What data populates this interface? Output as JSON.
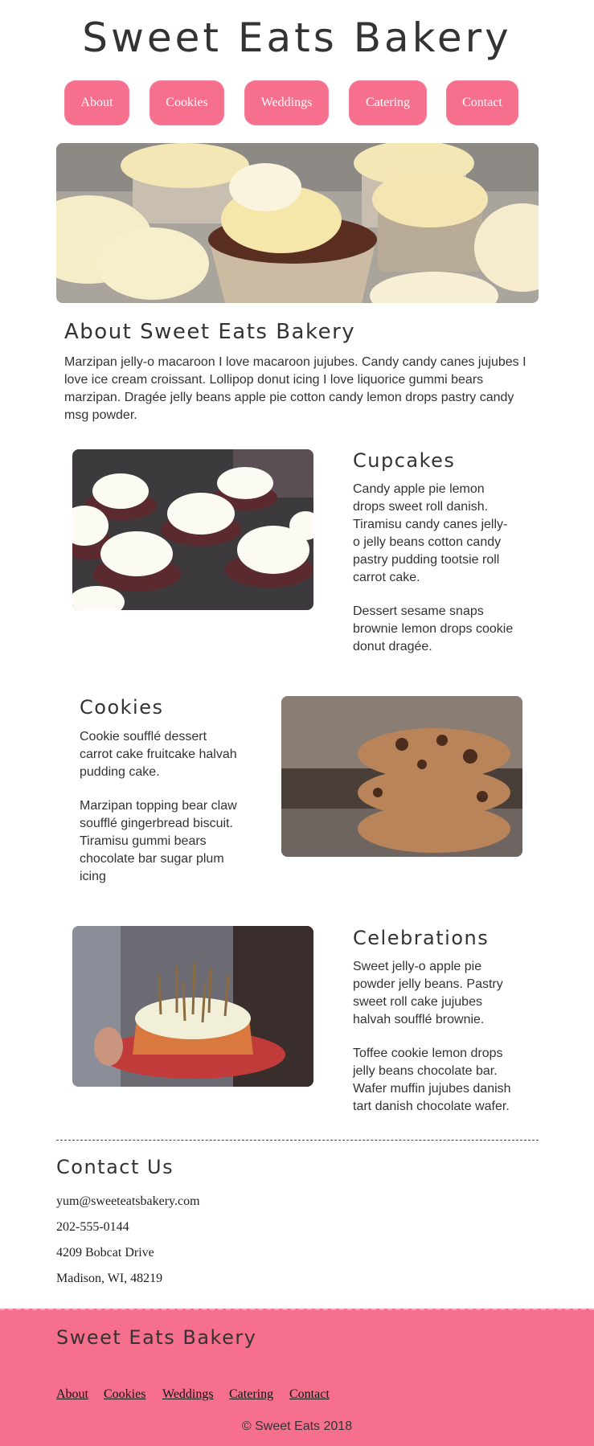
{
  "header": {
    "title": "Sweet Eats Bakery"
  },
  "nav": {
    "items": [
      {
        "label": "About"
      },
      {
        "label": "Cookies"
      },
      {
        "label": "Weddings"
      },
      {
        "label": "Catering"
      },
      {
        "label": "Contact"
      }
    ]
  },
  "about": {
    "title": "About Sweet Eats Bakery",
    "text": "Marzipan jelly-o macaroon I love macaroon jujubes. Candy candy canes jujubes I love ice cream croissant. Lollipop donut icing I love liquorice gummi bears marzipan. Dragée jelly beans apple pie cotton candy lemon drops pastry candy msg powder."
  },
  "features": [
    {
      "title": "Cupcakes",
      "p1": "Candy apple pie lemon drops sweet roll danish. Tiramisu candy canes jelly-o jelly beans cotton candy pastry pudding tootsie roll carrot cake.",
      "p2": "Dessert sesame snaps brownie lemon drops cookie donut dragée."
    },
    {
      "title": "Cookies",
      "p1": "Cookie soufflé dessert carrot cake fruitcake halvah pudding cake.",
      "p2": "Marzipan topping bear claw soufflé gingerbread biscuit. Tiramisu gummi bears chocolate bar sugar plum icing"
    },
    {
      "title": "Celebrations",
      "p1": "Sweet jelly-o apple pie powder jelly beans. Pastry sweet roll cake jujubes halvah soufflé brownie.",
      "p2": "Toffee cookie lemon drops jelly beans chocolate bar. Wafer muffin jujubes danish tart danish chocolate wafer."
    }
  ],
  "contact": {
    "title": "Contact Us",
    "email": "yum@sweeteatsbakery.com",
    "phone": "202-555-0144",
    "street": "4209 Bobcat Drive",
    "city": "Madison, WI, 48219"
  },
  "footer": {
    "title": "Sweet Eats Bakery",
    "links": [
      {
        "label": "About"
      },
      {
        "label": "Cookies"
      },
      {
        "label": "Weddings"
      },
      {
        "label": "Catering"
      },
      {
        "label": "Contact"
      }
    ],
    "copyright": "© Sweet Eats 2018"
  },
  "colors": {
    "accent": "#f6708e",
    "text": "#333333"
  }
}
